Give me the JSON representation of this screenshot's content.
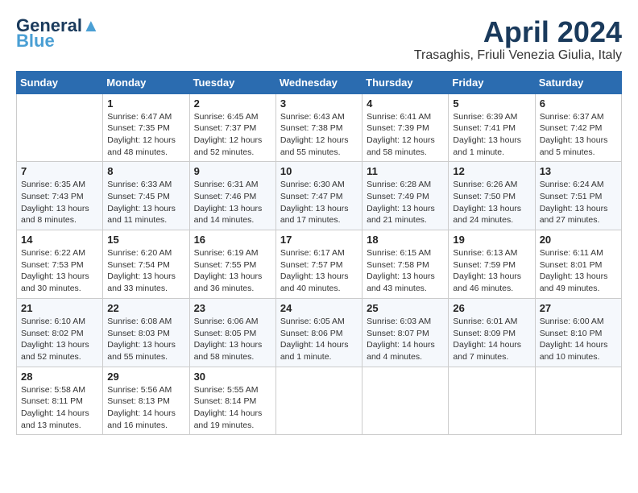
{
  "header": {
    "logo_line1": "General",
    "logo_line2": "Blue",
    "month": "April 2024",
    "location": "Trasaghis, Friuli Venezia Giulia, Italy"
  },
  "weekdays": [
    "Sunday",
    "Monday",
    "Tuesday",
    "Wednesday",
    "Thursday",
    "Friday",
    "Saturday"
  ],
  "weeks": [
    [
      {
        "day": "",
        "sunrise": "",
        "sunset": "",
        "daylight": ""
      },
      {
        "day": "1",
        "sunrise": "Sunrise: 6:47 AM",
        "sunset": "Sunset: 7:35 PM",
        "daylight": "Daylight: 12 hours and 48 minutes."
      },
      {
        "day": "2",
        "sunrise": "Sunrise: 6:45 AM",
        "sunset": "Sunset: 7:37 PM",
        "daylight": "Daylight: 12 hours and 52 minutes."
      },
      {
        "day": "3",
        "sunrise": "Sunrise: 6:43 AM",
        "sunset": "Sunset: 7:38 PM",
        "daylight": "Daylight: 12 hours and 55 minutes."
      },
      {
        "day": "4",
        "sunrise": "Sunrise: 6:41 AM",
        "sunset": "Sunset: 7:39 PM",
        "daylight": "Daylight: 12 hours and 58 minutes."
      },
      {
        "day": "5",
        "sunrise": "Sunrise: 6:39 AM",
        "sunset": "Sunset: 7:41 PM",
        "daylight": "Daylight: 13 hours and 1 minute."
      },
      {
        "day": "6",
        "sunrise": "Sunrise: 6:37 AM",
        "sunset": "Sunset: 7:42 PM",
        "daylight": "Daylight: 13 hours and 5 minutes."
      }
    ],
    [
      {
        "day": "7",
        "sunrise": "Sunrise: 6:35 AM",
        "sunset": "Sunset: 7:43 PM",
        "daylight": "Daylight: 13 hours and 8 minutes."
      },
      {
        "day": "8",
        "sunrise": "Sunrise: 6:33 AM",
        "sunset": "Sunset: 7:45 PM",
        "daylight": "Daylight: 13 hours and 11 minutes."
      },
      {
        "day": "9",
        "sunrise": "Sunrise: 6:31 AM",
        "sunset": "Sunset: 7:46 PM",
        "daylight": "Daylight: 13 hours and 14 minutes."
      },
      {
        "day": "10",
        "sunrise": "Sunrise: 6:30 AM",
        "sunset": "Sunset: 7:47 PM",
        "daylight": "Daylight: 13 hours and 17 minutes."
      },
      {
        "day": "11",
        "sunrise": "Sunrise: 6:28 AM",
        "sunset": "Sunset: 7:49 PM",
        "daylight": "Daylight: 13 hours and 21 minutes."
      },
      {
        "day": "12",
        "sunrise": "Sunrise: 6:26 AM",
        "sunset": "Sunset: 7:50 PM",
        "daylight": "Daylight: 13 hours and 24 minutes."
      },
      {
        "day": "13",
        "sunrise": "Sunrise: 6:24 AM",
        "sunset": "Sunset: 7:51 PM",
        "daylight": "Daylight: 13 hours and 27 minutes."
      }
    ],
    [
      {
        "day": "14",
        "sunrise": "Sunrise: 6:22 AM",
        "sunset": "Sunset: 7:53 PM",
        "daylight": "Daylight: 13 hours and 30 minutes."
      },
      {
        "day": "15",
        "sunrise": "Sunrise: 6:20 AM",
        "sunset": "Sunset: 7:54 PM",
        "daylight": "Daylight: 13 hours and 33 minutes."
      },
      {
        "day": "16",
        "sunrise": "Sunrise: 6:19 AM",
        "sunset": "Sunset: 7:55 PM",
        "daylight": "Daylight: 13 hours and 36 minutes."
      },
      {
        "day": "17",
        "sunrise": "Sunrise: 6:17 AM",
        "sunset": "Sunset: 7:57 PM",
        "daylight": "Daylight: 13 hours and 40 minutes."
      },
      {
        "day": "18",
        "sunrise": "Sunrise: 6:15 AM",
        "sunset": "Sunset: 7:58 PM",
        "daylight": "Daylight: 13 hours and 43 minutes."
      },
      {
        "day": "19",
        "sunrise": "Sunrise: 6:13 AM",
        "sunset": "Sunset: 7:59 PM",
        "daylight": "Daylight: 13 hours and 46 minutes."
      },
      {
        "day": "20",
        "sunrise": "Sunrise: 6:11 AM",
        "sunset": "Sunset: 8:01 PM",
        "daylight": "Daylight: 13 hours and 49 minutes."
      }
    ],
    [
      {
        "day": "21",
        "sunrise": "Sunrise: 6:10 AM",
        "sunset": "Sunset: 8:02 PM",
        "daylight": "Daylight: 13 hours and 52 minutes."
      },
      {
        "day": "22",
        "sunrise": "Sunrise: 6:08 AM",
        "sunset": "Sunset: 8:03 PM",
        "daylight": "Daylight: 13 hours and 55 minutes."
      },
      {
        "day": "23",
        "sunrise": "Sunrise: 6:06 AM",
        "sunset": "Sunset: 8:05 PM",
        "daylight": "Daylight: 13 hours and 58 minutes."
      },
      {
        "day": "24",
        "sunrise": "Sunrise: 6:05 AM",
        "sunset": "Sunset: 8:06 PM",
        "daylight": "Daylight: 14 hours and 1 minute."
      },
      {
        "day": "25",
        "sunrise": "Sunrise: 6:03 AM",
        "sunset": "Sunset: 8:07 PM",
        "daylight": "Daylight: 14 hours and 4 minutes."
      },
      {
        "day": "26",
        "sunrise": "Sunrise: 6:01 AM",
        "sunset": "Sunset: 8:09 PM",
        "daylight": "Daylight: 14 hours and 7 minutes."
      },
      {
        "day": "27",
        "sunrise": "Sunrise: 6:00 AM",
        "sunset": "Sunset: 8:10 PM",
        "daylight": "Daylight: 14 hours and 10 minutes."
      }
    ],
    [
      {
        "day": "28",
        "sunrise": "Sunrise: 5:58 AM",
        "sunset": "Sunset: 8:11 PM",
        "daylight": "Daylight: 14 hours and 13 minutes."
      },
      {
        "day": "29",
        "sunrise": "Sunrise: 5:56 AM",
        "sunset": "Sunset: 8:13 PM",
        "daylight": "Daylight: 14 hours and 16 minutes."
      },
      {
        "day": "30",
        "sunrise": "Sunrise: 5:55 AM",
        "sunset": "Sunset: 8:14 PM",
        "daylight": "Daylight: 14 hours and 19 minutes."
      },
      {
        "day": "",
        "sunrise": "",
        "sunset": "",
        "daylight": ""
      },
      {
        "day": "",
        "sunrise": "",
        "sunset": "",
        "daylight": ""
      },
      {
        "day": "",
        "sunrise": "",
        "sunset": "",
        "daylight": ""
      },
      {
        "day": "",
        "sunrise": "",
        "sunset": "",
        "daylight": ""
      }
    ]
  ]
}
